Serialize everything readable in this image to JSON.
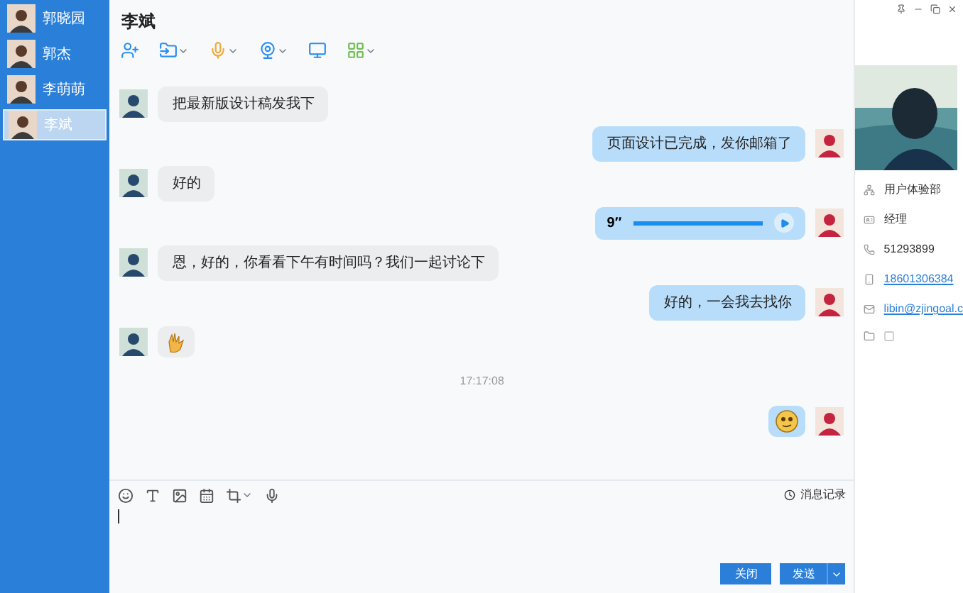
{
  "contacts": [
    {
      "name": "郭晓园",
      "selected": false
    },
    {
      "name": "郭杰",
      "selected": false
    },
    {
      "name": "李萌萌",
      "selected": false
    },
    {
      "name": "李斌",
      "selected": true
    }
  ],
  "chat": {
    "title": "李斌"
  },
  "messages": [
    {
      "kind": "text",
      "outgoing": false,
      "text": "把最新版设计稿发我下"
    },
    {
      "kind": "text",
      "outgoing": true,
      "text": "页面设计已完成，发你邮箱了"
    },
    {
      "kind": "text",
      "outgoing": false,
      "text": "好的"
    },
    {
      "kind": "voice",
      "outgoing": true,
      "duration": "9″",
      "level": 1
    },
    {
      "kind": "text",
      "outgoing": false,
      "text": "恩，好的，你看看下午有时间吗？我们一起讨论下"
    },
    {
      "kind": "text",
      "outgoing": true,
      "text": "好的，一会我去找你"
    },
    {
      "kind": "hand-sticker",
      "outgoing": false
    },
    {
      "kind": "time",
      "text": "17:17:08"
    },
    {
      "kind": "face-sticker",
      "outgoing": true
    }
  ],
  "composer": {
    "history_link": "消息记录",
    "buttons": [
      "关闭",
      "发送"
    ]
  },
  "profile": {
    "fields": [
      {
        "kind": "department",
        "text": "用户体验部",
        "link": false
      },
      {
        "kind": "title",
        "text": "经理",
        "link": false
      },
      {
        "kind": "phone",
        "text": "51293899",
        "link": false
      },
      {
        "kind": "mobile",
        "text": "18601306384",
        "link": true
      },
      {
        "kind": "email",
        "text": "libin@zjingoal.c",
        "link": true
      }
    ]
  }
}
